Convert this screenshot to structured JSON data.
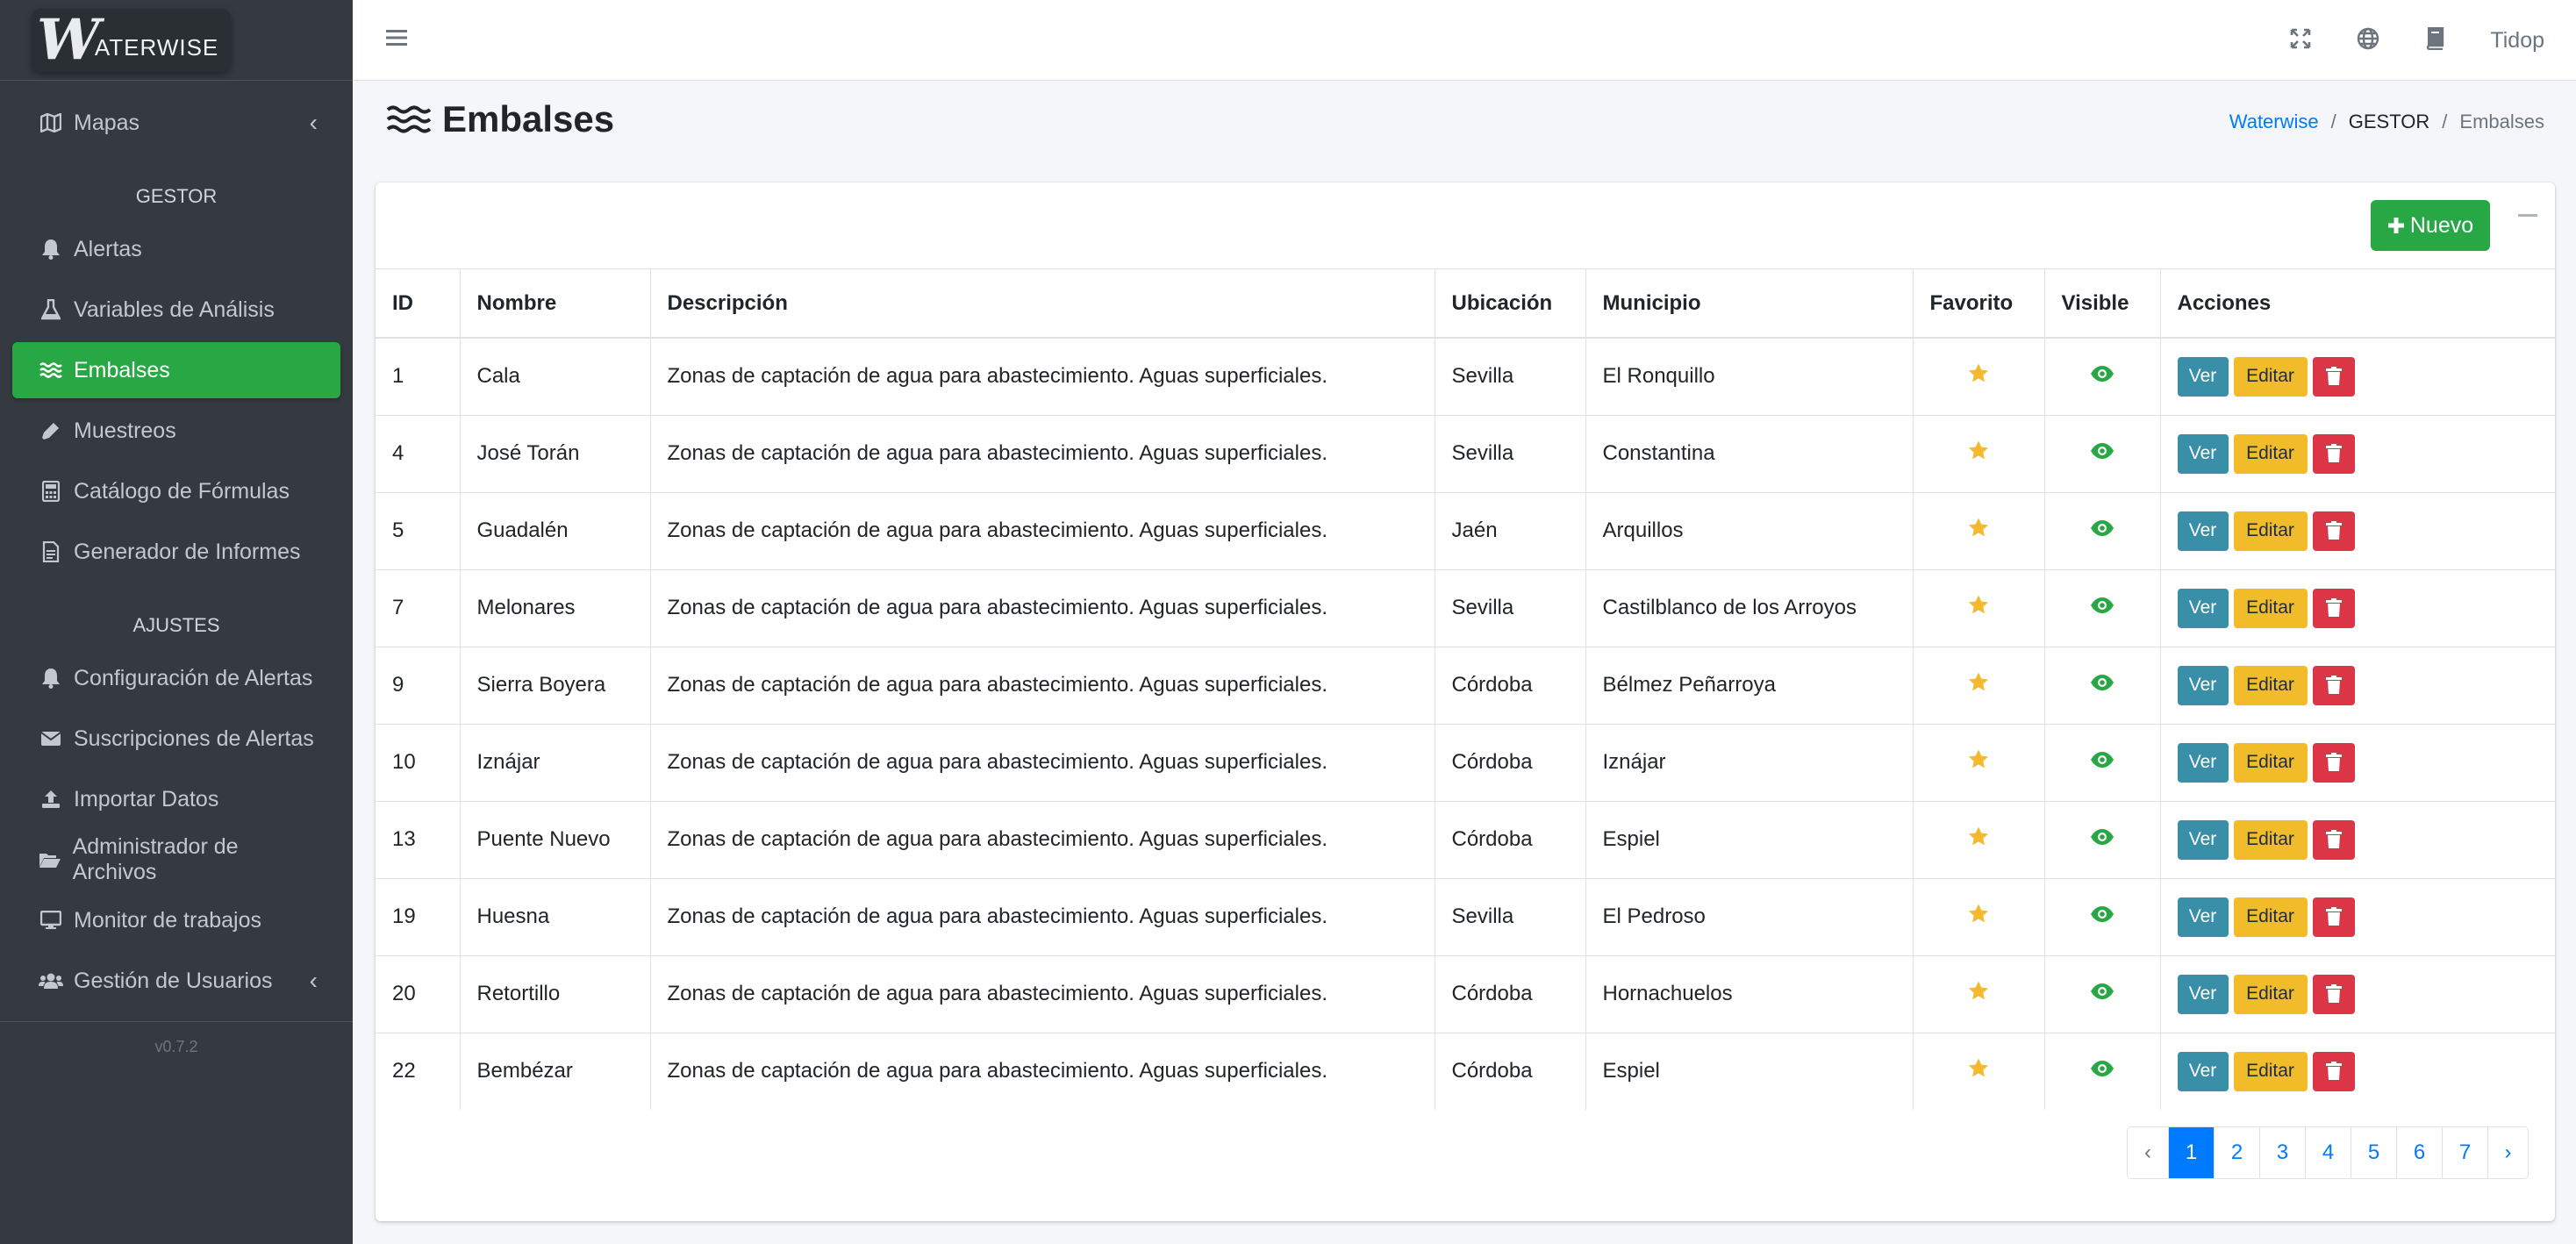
{
  "brand": {
    "mark": "W",
    "name": "ATERWISE"
  },
  "sidebar": {
    "mapas": {
      "label": "Mapas",
      "icon": "map-icon"
    },
    "gestor_header": "GESTOR",
    "gestor_items": [
      {
        "label": "Alertas",
        "icon": "bell-icon"
      },
      {
        "label": "Variables de Análisis",
        "icon": "flask-icon"
      },
      {
        "label": "Embalses",
        "icon": "water-icon",
        "active": true
      },
      {
        "label": "Muestreos",
        "icon": "eyedropper-icon"
      },
      {
        "label": "Catálogo de Fórmulas",
        "icon": "calculator-icon"
      },
      {
        "label": "Generador de Informes",
        "icon": "file-icon"
      }
    ],
    "ajustes_header": "AJUSTES",
    "ajustes_items": [
      {
        "label": "Configuración de Alertas",
        "icon": "bell-icon"
      },
      {
        "label": "Suscripciones de Alertas",
        "icon": "envelope-icon"
      },
      {
        "label": "Importar Datos",
        "icon": "upload-icon"
      },
      {
        "label": "Administrador de Archivos",
        "icon": "folder-open-icon"
      },
      {
        "label": "Monitor de trabajos",
        "icon": "desktop-icon"
      },
      {
        "label": "Gestión de Usuarios",
        "icon": "users-icon"
      }
    ],
    "version": "v0.7.2",
    "active_color": "#28a745"
  },
  "topbar": {
    "user": "Tidop"
  },
  "page": {
    "title": "Embalses"
  },
  "breadcrumb": {
    "home": "Waterwise",
    "section": "GESTOR",
    "current": "Embalses"
  },
  "card": {
    "new_button": "Nuevo"
  },
  "table": {
    "headers": [
      "ID",
      "Nombre",
      "Descripción",
      "Ubicación",
      "Municipio",
      "Favorito",
      "Visible",
      "Acciones"
    ],
    "rows": [
      {
        "id": "1",
        "nombre": "Cala",
        "descripcion": "Zonas de captación de agua para abastecimiento. Aguas superficiales.",
        "ubicacion": "Sevilla",
        "municipio": "El Ronquillo"
      },
      {
        "id": "4",
        "nombre": "José Torán",
        "descripcion": "Zonas de captación de agua para abastecimiento. Aguas superficiales.",
        "ubicacion": "Sevilla",
        "municipio": "Constantina"
      },
      {
        "id": "5",
        "nombre": "Guadalén",
        "descripcion": "Zonas de captación de agua para abastecimiento. Aguas superficiales.",
        "ubicacion": "Jaén",
        "municipio": "Arquillos"
      },
      {
        "id": "7",
        "nombre": "Melonares",
        "descripcion": "Zonas de captación de agua para abastecimiento. Aguas superficiales.",
        "ubicacion": "Sevilla",
        "municipio": "Castilblanco de los Arroyos"
      },
      {
        "id": "9",
        "nombre": "Sierra Boyera",
        "descripcion": "Zonas de captación de agua para abastecimiento. Aguas superficiales.",
        "ubicacion": "Córdoba",
        "municipio": "Bélmez Peñarroya"
      },
      {
        "id": "10",
        "nombre": "Iznájar",
        "descripcion": "Zonas de captación de agua para abastecimiento. Aguas superficiales.",
        "ubicacion": "Córdoba",
        "municipio": "Iznájar"
      },
      {
        "id": "13",
        "nombre": "Puente Nuevo",
        "descripcion": "Zonas de captación de agua para abastecimiento. Aguas superficiales.",
        "ubicacion": "Córdoba",
        "municipio": "Espiel"
      },
      {
        "id": "19",
        "nombre": "Huesna",
        "descripcion": "Zonas de captación de agua para abastecimiento. Aguas superficiales.",
        "ubicacion": "Sevilla",
        "municipio": "El Pedroso"
      },
      {
        "id": "20",
        "nombre": "Retortillo",
        "descripcion": "Zonas de captación de agua para abastecimiento. Aguas superficiales.",
        "ubicacion": "Córdoba",
        "municipio": "Hornachuelos"
      },
      {
        "id": "22",
        "nombre": "Bembézar",
        "descripcion": "Zonas de captación de agua para abastecimiento. Aguas superficiales.",
        "ubicacion": "Córdoba",
        "municipio": "Espiel"
      }
    ],
    "actions": {
      "view": "Ver",
      "edit": "Editar"
    },
    "favorite_color": "#f5b82e",
    "visible_color": "#28a745"
  },
  "pagination": {
    "prev": "‹",
    "pages": [
      "1",
      "2",
      "3",
      "4",
      "5",
      "6",
      "7"
    ],
    "next": "›",
    "current": "1"
  }
}
